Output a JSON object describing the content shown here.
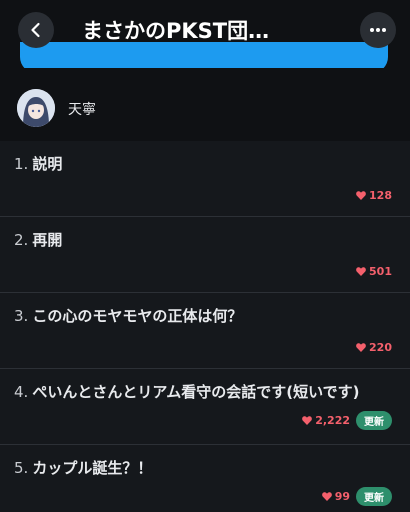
{
  "header": {
    "title": "まさかのPKST団…"
  },
  "author": {
    "name": "天寧"
  },
  "items": [
    {
      "num": "1.",
      "title": "説明",
      "likes": "128",
      "badge": ""
    },
    {
      "num": "2.",
      "title": "再開",
      "likes": "501",
      "badge": ""
    },
    {
      "num": "3.",
      "title": "この心のモヤモヤの正体は何？",
      "likes": "220",
      "badge": ""
    },
    {
      "num": "4.",
      "title": "ぺいんとさんとリアム看守の会話です(短いです)",
      "likes": "2,222",
      "badge": "更新"
    },
    {
      "num": "5.",
      "title": "カップル誕生？！",
      "likes": "99",
      "badge": "更新"
    }
  ],
  "colors": {
    "accent_blue": "#1d9bf0",
    "heart": "#f4606c",
    "badge_green": "#2e8f6c"
  }
}
